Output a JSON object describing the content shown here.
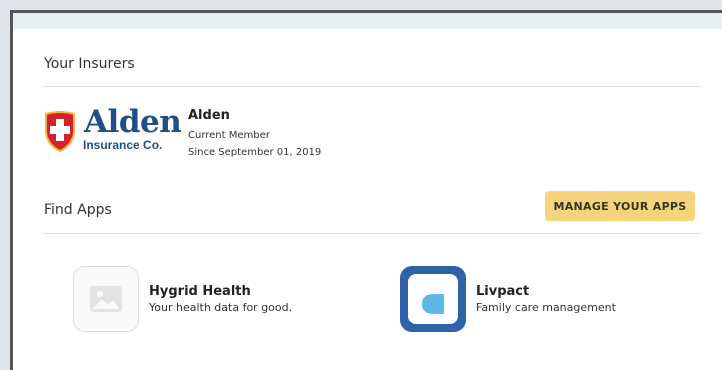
{
  "insurers": {
    "title": "Your Insurers",
    "items": [
      {
        "logo_text": "Alden",
        "logo_subtext": "Insurance Co.",
        "name": "Alden",
        "status": "Current Member",
        "since": "Since September 01, 2019"
      }
    ]
  },
  "apps": {
    "title": "Find Apps",
    "manage_label": "MANAGE YOUR APPS",
    "items": [
      {
        "name": "Hygrid Health",
        "description": "Your health data for good.",
        "icon": "image-placeholder-icon"
      },
      {
        "name": "Livpact",
        "description": "Family care management",
        "icon": "livpact-logo-icon"
      }
    ]
  },
  "colors": {
    "button_bg": "#f6d47b",
    "logo_blue": "#1f4f86",
    "shield_red": "#d4212e",
    "livpact_blue": "#2f63a9"
  }
}
